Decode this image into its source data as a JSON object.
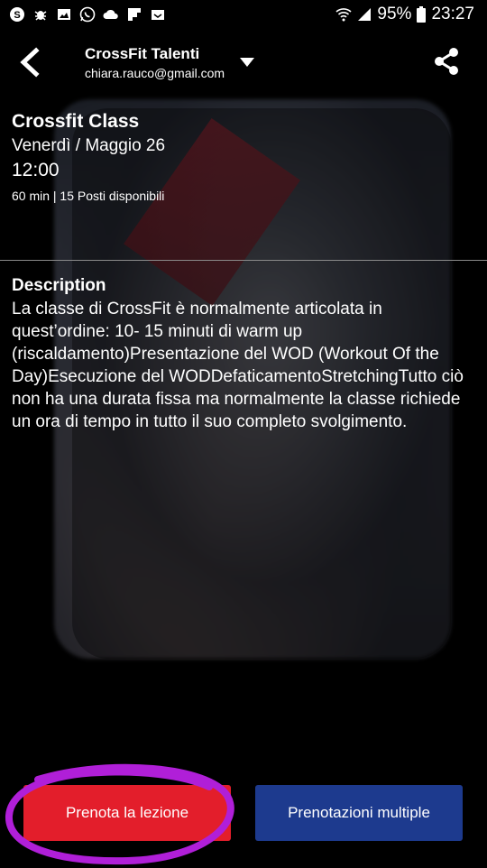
{
  "status_bar": {
    "battery": "95%",
    "time": "23:27"
  },
  "app_bar": {
    "account_name": "CrossFit Talenti",
    "account_email": "chiara.rauco@gmail.com"
  },
  "class": {
    "title": "Crossfit Class",
    "date": "Venerdì / Maggio 26",
    "time": "12:00",
    "meta": "60 min | 15 Posti disponibili"
  },
  "description": {
    "heading": "Description",
    "text": "La classe di CrossFit è normalmente articolata in quest’ordine: 10- 15 minuti di warm up (riscaldamento)Presentazione del WOD (Workout Of the Day)Esecuzione del WODDefaticamentoStretchingTutto ciò non ha una durata fissa ma normalmente la classe richiede un ora di tempo in tutto il suo completo svolgimento."
  },
  "buttons": {
    "book": "Prenota la lezione",
    "multi": "Prenotazioni multiple"
  },
  "colors": {
    "book_button": "#e31e2b",
    "multi_button": "#1d3a8e",
    "annotation_circle": "#b01fd8"
  }
}
